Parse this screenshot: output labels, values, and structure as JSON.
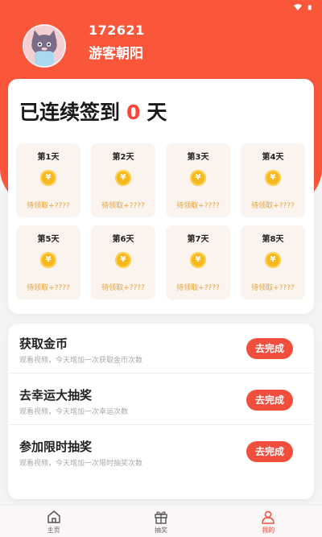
{
  "user": {
    "id": "172621",
    "name": "游客朝阳"
  },
  "checkin": {
    "title_prefix": "已连续签到",
    "streak": "0",
    "title_suffix": "天",
    "days": [
      {
        "label": "第1天",
        "reward": "待领取+????"
      },
      {
        "label": "第2天",
        "reward": "待领取+????"
      },
      {
        "label": "第3天",
        "reward": "待领取+????"
      },
      {
        "label": "第4天",
        "reward": "待领取+????"
      },
      {
        "label": "第5天",
        "reward": "待领取+????"
      },
      {
        "label": "第6天",
        "reward": "待领取+????"
      },
      {
        "label": "第7天",
        "reward": "待领取+????"
      },
      {
        "label": "第8天",
        "reward": "待领取+????"
      }
    ],
    "coin_symbol": "¥"
  },
  "tasks": [
    {
      "title": "获取金币",
      "desc": "观看视频，今天增加一次获取金币次数",
      "button": "去完成"
    },
    {
      "title": "去幸运大抽奖",
      "desc": "观看视频，今天增加一次幸运次数",
      "button": "去完成"
    },
    {
      "title": "参加限时抽奖",
      "desc": "观看视频，今天增加一次限时抽奖次数",
      "button": "去完成"
    }
  ],
  "tabbar": {
    "items": [
      {
        "label": "主页",
        "icon": "home-icon"
      },
      {
        "label": "抽奖",
        "icon": "gift-icon"
      },
      {
        "label": "我的",
        "icon": "user-icon"
      }
    ],
    "active": "我的"
  },
  "colors": {
    "primary": "#f9563a",
    "button": "#f24e3e",
    "reward_text": "#e8a33b",
    "coin": "#f7b81e"
  }
}
